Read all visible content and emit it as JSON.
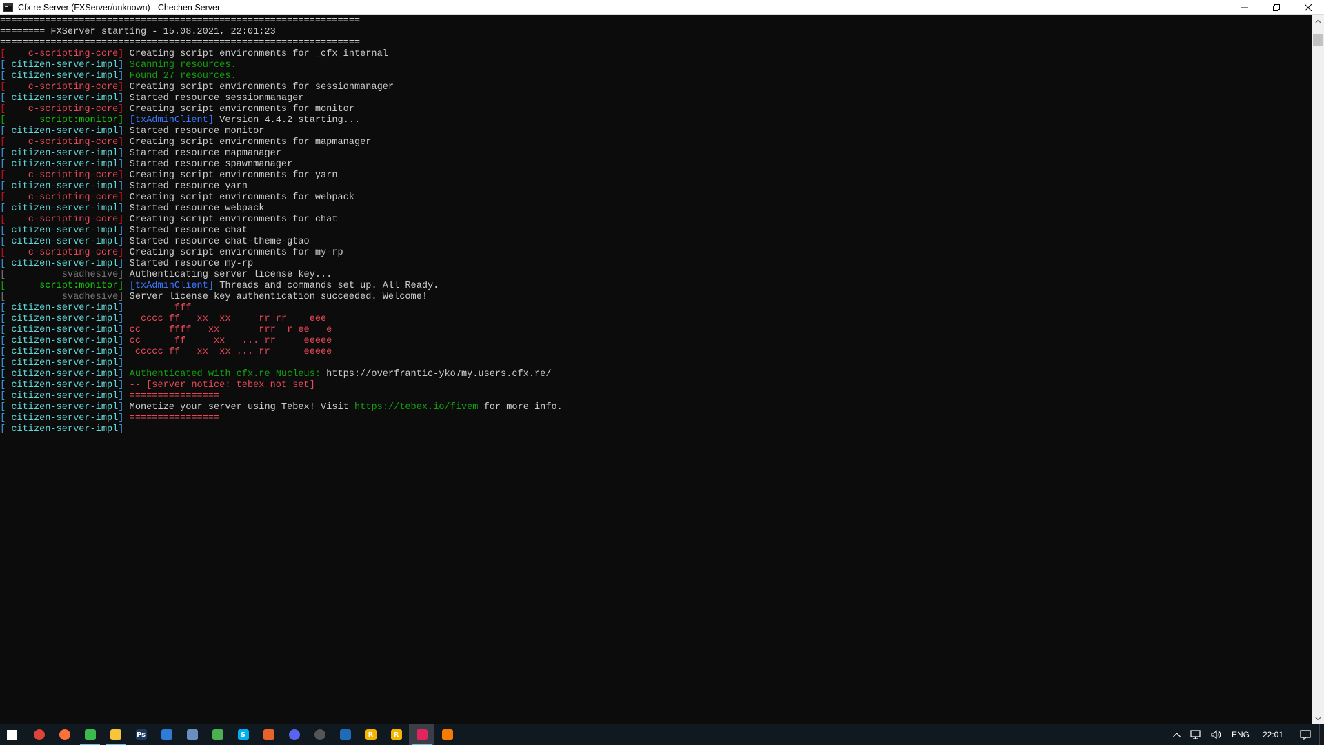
{
  "window": {
    "title": "Cfx.re Server (FXServer/unknown) - Chechen Server",
    "minimize_icon": "minimize-icon",
    "restore_icon": "restore-icon",
    "close_icon": "close-icon"
  },
  "console": {
    "lines": [
      {
        "tag": "",
        "tag_color": "none",
        "segments": [
          {
            "text": "================================================================",
            "color": "white"
          }
        ]
      },
      {
        "tag": "",
        "tag_color": "none",
        "segments": [
          {
            "text": "======== FXServer starting - 15.08.2021, 22:01:23",
            "color": "white"
          }
        ]
      },
      {
        "tag": "",
        "tag_color": "none",
        "segments": [
          {
            "text": "================================================================",
            "color": "white"
          }
        ]
      },
      {
        "tag": "    c-scripting-core",
        "tag_color": "red",
        "segments": [
          {
            "text": "Creating script environments for _cfx_internal",
            "color": "white"
          }
        ]
      },
      {
        "tag": " citizen-server-impl",
        "tag_color": "cyan",
        "segments": [
          {
            "text": "Scanning resources.",
            "color": "green2"
          }
        ]
      },
      {
        "tag": " citizen-server-impl",
        "tag_color": "cyan",
        "segments": [
          {
            "text": "Found 27 resources.",
            "color": "green2"
          }
        ]
      },
      {
        "tag": "    c-scripting-core",
        "tag_color": "red",
        "segments": [
          {
            "text": "Creating script environments for sessionmanager",
            "color": "white"
          }
        ]
      },
      {
        "tag": " citizen-server-impl",
        "tag_color": "cyan",
        "segments": [
          {
            "text": "Started resource sessionmanager",
            "color": "white"
          }
        ]
      },
      {
        "tag": "    c-scripting-core",
        "tag_color": "red",
        "segments": [
          {
            "text": "Creating script environments for monitor",
            "color": "white"
          }
        ]
      },
      {
        "tag": "      script:monitor",
        "tag_color": "green",
        "segments": [
          {
            "text": "[txAdminClient]",
            "color": "blue"
          },
          {
            "text": " Version 4.4.2 starting...",
            "color": "white"
          }
        ]
      },
      {
        "tag": " citizen-server-impl",
        "tag_color": "cyan",
        "segments": [
          {
            "text": "Started resource monitor",
            "color": "white"
          }
        ]
      },
      {
        "tag": "    c-scripting-core",
        "tag_color": "red",
        "segments": [
          {
            "text": "Creating script environments for mapmanager",
            "color": "white"
          }
        ]
      },
      {
        "tag": " citizen-server-impl",
        "tag_color": "cyan",
        "segments": [
          {
            "text": "Started resource mapmanager",
            "color": "white"
          }
        ]
      },
      {
        "tag": " citizen-server-impl",
        "tag_color": "cyan",
        "segments": [
          {
            "text": "Started resource spawnmanager",
            "color": "white"
          }
        ]
      },
      {
        "tag": "    c-scripting-core",
        "tag_color": "red",
        "segments": [
          {
            "text": "Creating script environments for yarn",
            "color": "white"
          }
        ]
      },
      {
        "tag": " citizen-server-impl",
        "tag_color": "cyan",
        "segments": [
          {
            "text": "Started resource yarn",
            "color": "white"
          }
        ]
      },
      {
        "tag": "    c-scripting-core",
        "tag_color": "red",
        "segments": [
          {
            "text": "Creating script environments for webpack",
            "color": "white"
          }
        ]
      },
      {
        "tag": " citizen-server-impl",
        "tag_color": "cyan",
        "segments": [
          {
            "text": "Started resource webpack",
            "color": "white"
          }
        ]
      },
      {
        "tag": "    c-scripting-core",
        "tag_color": "red",
        "segments": [
          {
            "text": "Creating script environments for chat",
            "color": "white"
          }
        ]
      },
      {
        "tag": " citizen-server-impl",
        "tag_color": "cyan",
        "segments": [
          {
            "text": "Started resource chat",
            "color": "white"
          }
        ]
      },
      {
        "tag": " citizen-server-impl",
        "tag_color": "cyan",
        "segments": [
          {
            "text": "Started resource chat-theme-gtao",
            "color": "white"
          }
        ]
      },
      {
        "tag": "    c-scripting-core",
        "tag_color": "red",
        "segments": [
          {
            "text": "Creating script environments for my-rp",
            "color": "white"
          }
        ]
      },
      {
        "tag": " citizen-server-impl",
        "tag_color": "cyan",
        "segments": [
          {
            "text": "Started resource my-rp",
            "color": "white"
          }
        ]
      },
      {
        "tag": "          svadhesive",
        "tag_color": "gray",
        "segments": [
          {
            "text": "Authenticating server license key...",
            "color": "white"
          }
        ]
      },
      {
        "tag": "      script:monitor",
        "tag_color": "green",
        "segments": [
          {
            "text": "[txAdminClient]",
            "color": "blue"
          },
          {
            "text": " Threads and commands set up. All Ready.",
            "color": "white"
          }
        ]
      },
      {
        "tag": "          svadhesive",
        "tag_color": "gray",
        "segments": [
          {
            "text": "Server license key authentication succeeded. Welcome!",
            "color": "white"
          }
        ]
      },
      {
        "tag": " citizen-server-impl",
        "tag_color": "cyan",
        "segments": [
          {
            "text": "        fff",
            "color": "red2"
          }
        ]
      },
      {
        "tag": " citizen-server-impl",
        "tag_color": "cyan",
        "segments": [
          {
            "text": "  cccc ff   xx  xx     rr rr    eee",
            "color": "red2"
          }
        ]
      },
      {
        "tag": " citizen-server-impl",
        "tag_color": "cyan",
        "segments": [
          {
            "text": "cc     ffff   xx       rrr  r ee   e",
            "color": "red2"
          }
        ]
      },
      {
        "tag": " citizen-server-impl",
        "tag_color": "cyan",
        "segments": [
          {
            "text": "cc      ff     xx   ... rr     eeeee",
            "color": "red2"
          }
        ]
      },
      {
        "tag": " citizen-server-impl",
        "tag_color": "cyan",
        "segments": [
          {
            "text": " ccccc ff   xx  xx ... rr      eeeee",
            "color": "red2"
          }
        ]
      },
      {
        "tag": " citizen-server-impl",
        "tag_color": "cyan",
        "segments": [
          {
            "text": "",
            "color": "white"
          }
        ]
      },
      {
        "tag": " citizen-server-impl",
        "tag_color": "cyan",
        "segments": [
          {
            "text": "Authenticated with cfx.re Nucleus: ",
            "color": "green2"
          },
          {
            "text": "https://overfrantic-yko7my.users.cfx.re/",
            "color": "white"
          }
        ]
      },
      {
        "tag": " citizen-server-impl",
        "tag_color": "cyan",
        "segments": [
          {
            "text": "-- [server notice: tebex_not_set]",
            "color": "red2"
          }
        ]
      },
      {
        "tag": " citizen-server-impl",
        "tag_color": "cyan",
        "segments": [
          {
            "text": "================",
            "color": "red2"
          }
        ]
      },
      {
        "tag": " citizen-server-impl",
        "tag_color": "cyan",
        "segments": [
          {
            "text": "Monetize your server using Tebex! Visit ",
            "color": "white"
          },
          {
            "text": "https://tebex.io/fivem",
            "color": "green2"
          },
          {
            "text": " for more info.",
            "color": "white"
          }
        ]
      },
      {
        "tag": " citizen-server-impl",
        "tag_color": "cyan",
        "segments": [
          {
            "text": "================",
            "color": "red2"
          }
        ]
      },
      {
        "tag": " citizen-server-impl",
        "tag_color": "cyan",
        "segments": [
          {
            "text": "",
            "color": "white"
          }
        ]
      }
    ]
  },
  "taskbar": {
    "apps": [
      {
        "name": "chrome-icon",
        "color": "#db4437",
        "glyph": "",
        "active": false,
        "open": false
      },
      {
        "name": "firefox-icon",
        "color": "#ff7139",
        "glyph": "",
        "active": false,
        "open": false
      },
      {
        "name": "notepad-icon",
        "color": "#3dba4e",
        "glyph": "",
        "active": false,
        "open": true
      },
      {
        "name": "file-explorer-icon",
        "color": "#f8c53a",
        "glyph": "",
        "active": false,
        "open": true
      },
      {
        "name": "photoshop-icon",
        "color": "#1c3a5e",
        "glyph": "Ps",
        "active": false,
        "open": false
      },
      {
        "name": "app-blue-icon",
        "color": "#2f7bd8",
        "glyph": "",
        "active": false,
        "open": false
      },
      {
        "name": "network-tool-icon",
        "color": "#6c8ebf",
        "glyph": "",
        "active": false,
        "open": false
      },
      {
        "name": "app-green-icon",
        "color": "#4caf50",
        "glyph": "",
        "active": false,
        "open": false
      },
      {
        "name": "skype-icon",
        "color": "#00aff0",
        "glyph": "S",
        "active": false,
        "open": false
      },
      {
        "name": "app-orange-icon",
        "color": "#e8632b",
        "glyph": "",
        "active": false,
        "open": false
      },
      {
        "name": "discord-icon",
        "color": "#5865f2",
        "glyph": "",
        "active": false,
        "open": false
      },
      {
        "name": "app-gray-icon",
        "color": "#555555",
        "glyph": "",
        "active": false,
        "open": false
      },
      {
        "name": "app-dark-blue-icon",
        "color": "#1e6bb8",
        "glyph": "",
        "active": false,
        "open": false
      },
      {
        "name": "rockstar-icon",
        "color": "#f4b400",
        "glyph": "R",
        "active": false,
        "open": false
      },
      {
        "name": "rockstar-icon-2",
        "color": "#f4b400",
        "glyph": "R",
        "active": false,
        "open": false
      },
      {
        "name": "fxserver-icon",
        "color": "#e0245e",
        "glyph": "",
        "active": true,
        "open": true
      },
      {
        "name": "app-orange-2-icon",
        "color": "#f57c00",
        "glyph": "",
        "active": false,
        "open": false
      }
    ],
    "language": "ENG",
    "clock": "22:01"
  }
}
